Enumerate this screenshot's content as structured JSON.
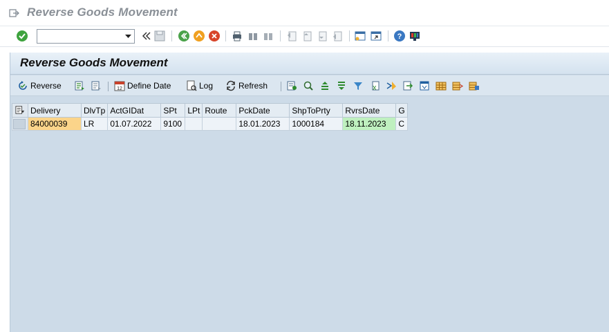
{
  "window": {
    "title": "Reverse Goods Movement"
  },
  "command_field": {
    "value": ""
  },
  "page": {
    "title": "Reverse Goods Movement"
  },
  "toolbar": {
    "reverse_label": "Reverse",
    "define_date_label": "Define Date",
    "log_label": "Log",
    "refresh_label": "Refresh"
  },
  "table": {
    "columns": [
      "Delivery",
      "DlvTp",
      "ActGIDat",
      "SPt",
      "LPt",
      "Route",
      "PckDate",
      "ShpToPrty",
      "RvrsDate",
      "G"
    ],
    "rows": [
      [
        "84000039",
        "LR",
        "01.07.2022",
        "9100",
        "",
        "",
        "18.01.2023",
        "1000184",
        "18.11.2023",
        "C"
      ]
    ]
  },
  "colors": {
    "content_bg": "#cddbe8",
    "highlight_orange": "#fbd48a",
    "highlight_green": "#bff0bf"
  }
}
